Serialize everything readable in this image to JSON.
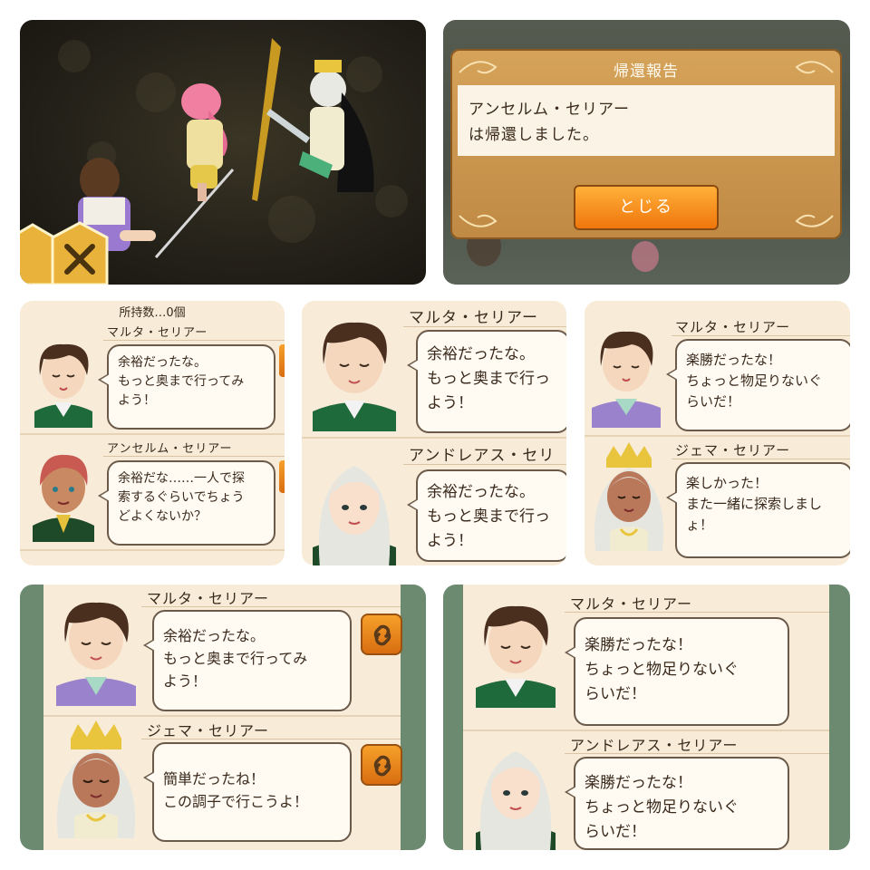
{
  "colors": {
    "panel_bg": "#f8ecd9",
    "accent": "#f08a1c",
    "dialog_header": "#c8934c",
    "bubble_border": "#6b5a4a"
  },
  "game_scene": {
    "icons": [
      "shield-icon",
      "swords-icon"
    ]
  },
  "return_dialog": {
    "title": "帰還報告",
    "message_line1": "アンセルム・セリアー",
    "message_line2": "は帰還しました。",
    "close_button": "とじる"
  },
  "panel1": {
    "header": "所持数…0個",
    "entries": [
      {
        "name": "マルタ・セリアー",
        "lines": [
          "余裕だったな。",
          "もっと奥まで行ってみ",
          "よう！"
        ]
      },
      {
        "name": "アンセルム・セリアー",
        "lines": [
          "余裕だな……一人で探",
          "索するぐらいでちょう",
          "どよくないか？"
        ]
      }
    ]
  },
  "panel2": {
    "entries": [
      {
        "name": "マルタ・セリアー",
        "lines": [
          "余裕だったな。",
          "もっと奥まで行っ",
          "よう！"
        ]
      },
      {
        "name": "アンドレアス・セリ",
        "lines": [
          "余裕だったな。",
          "もっと奥まで行っ",
          "よう！"
        ]
      }
    ]
  },
  "panel3": {
    "entries": [
      {
        "name": "マルタ・セリアー",
        "lines": [
          "楽勝だったな！",
          "ちょっと物足りないぐ",
          "らいだ！"
        ]
      },
      {
        "name": "ジェマ・セリアー",
        "lines": [
          "楽しかった！",
          "また一緒に探索しまし",
          "ょ！"
        ]
      }
    ]
  },
  "panel4": {
    "entries": [
      {
        "name": "マルタ・セリアー",
        "lines": [
          "余裕だったな。",
          "もっと奥まで行ってみ",
          "よう！"
        ]
      },
      {
        "name": "ジェマ・セリアー",
        "lines": [
          "簡単だったね！",
          "この調子で行こうよ！"
        ]
      }
    ]
  },
  "panel5": {
    "entries": [
      {
        "name": "マルタ・セリアー",
        "lines": [
          "楽勝だったな！",
          "ちょっと物足りないぐ",
          "らいだ！"
        ]
      },
      {
        "name": "アンドレアス・セリアー",
        "lines": [
          "楽勝だったな！",
          "ちょっと物足りないぐ",
          "らいだ！"
        ]
      }
    ]
  }
}
